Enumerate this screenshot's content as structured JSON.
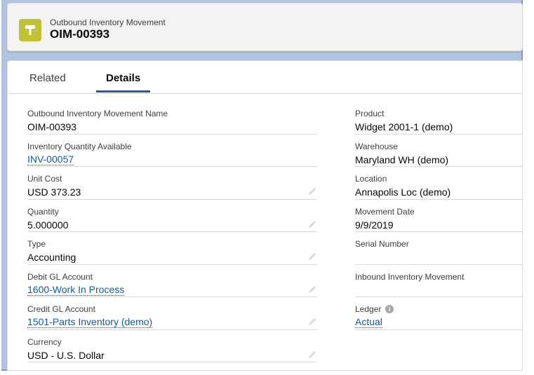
{
  "header": {
    "object_name": "Outbound Inventory Movement",
    "record_name": "OIM-00393",
    "icon": "hammer-icon"
  },
  "tabs": [
    {
      "label": "Related",
      "active": false
    },
    {
      "label": "Details",
      "active": true
    }
  ],
  "left_fields": [
    {
      "label": "Outbound Inventory Movement Name",
      "value": "OIM-00393",
      "link": false,
      "editable": false
    },
    {
      "label": "Inventory Quantity Available",
      "value": "INV-00057",
      "link": true,
      "editable": false
    },
    {
      "label": "Unit Cost",
      "value": "USD 373.23",
      "link": false,
      "editable": true
    },
    {
      "label": "Quantity",
      "value": "5.000000",
      "link": false,
      "editable": true
    },
    {
      "label": "Type",
      "value": "Accounting",
      "link": false,
      "editable": true
    },
    {
      "label": "Debit GL Account",
      "value": "1600-Work In Process",
      "link": true,
      "editable": true
    },
    {
      "label": "Credit GL Account",
      "value": "1501-Parts Inventory (demo)",
      "link": true,
      "editable": true
    },
    {
      "label": "Currency",
      "value": "USD - U.S. Dollar",
      "link": false,
      "editable": true
    }
  ],
  "right_fields": [
    {
      "label": "Product",
      "value": "Widget 2001-1 (demo)",
      "link": false
    },
    {
      "label": "Warehouse",
      "value": "Maryland WH (demo)",
      "link": false
    },
    {
      "label": "Location",
      "value": "Annapolis Loc (demo)",
      "link": false
    },
    {
      "label": "Movement Date",
      "value": "9/9/2019",
      "link": false
    },
    {
      "label": "Serial Number",
      "value": "",
      "link": false
    },
    {
      "label": "Inbound Inventory Movement",
      "value": "",
      "link": false
    },
    {
      "label": "Ledger",
      "value": "Actual",
      "link": true,
      "info": true
    },
    {
      "label": "",
      "value": "",
      "link": false,
      "empty": true
    }
  ],
  "colors": {
    "accent": "#1b5fae",
    "link": "#0b5cab",
    "icon_bg": "#c1c133",
    "frame": "#b0c4df"
  }
}
